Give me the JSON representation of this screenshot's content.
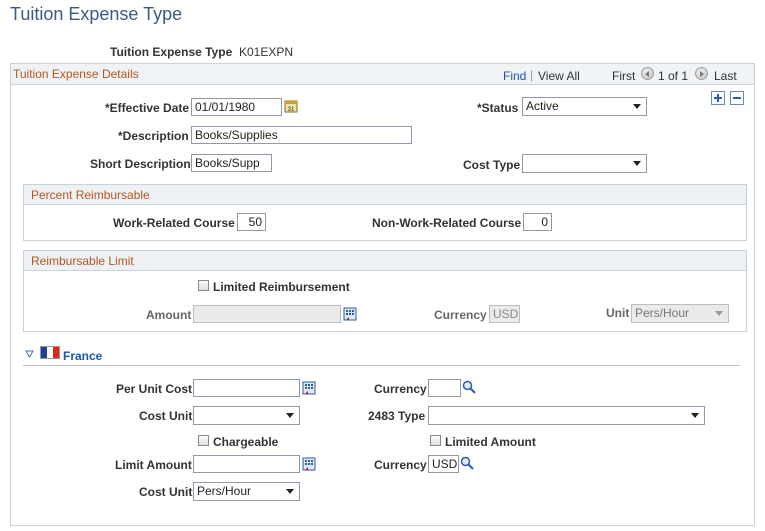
{
  "page": {
    "title": "Tuition Expense Type"
  },
  "header": {
    "type_label": "Tuition Expense Type",
    "type_value": "K01EXPN"
  },
  "details": {
    "title": "Tuition Expense Details",
    "nav": {
      "find": "Find",
      "sep": "|",
      "view_all": "View All",
      "first": "First",
      "position": "1 of 1",
      "last": "Last"
    },
    "effective_date_label": "*Effective Date",
    "effective_date_value": "01/01/1980",
    "status_label": "*Status",
    "status_value": "Active",
    "description_label": "*Description",
    "description_value": "Books/Supplies",
    "short_description_label": "Short Description",
    "short_description_value": "Books/Supp",
    "cost_type_label": "Cost Type",
    "cost_type_value": "",
    "percent": {
      "title": "Percent Reimbursable",
      "work_label": "Work-Related Course",
      "work_value": "50",
      "nonwork_label": "Non-Work-Related Course",
      "nonwork_value": "0"
    },
    "limit": {
      "title": "Reimbursable Limit",
      "limited_label": "Limited Reimbursement",
      "limited_checked": false,
      "amount_label": "Amount",
      "amount_value": "",
      "currency_label": "Currency",
      "currency_value": "USD",
      "unit_label": "Unit",
      "unit_value": "Pers/Hour"
    },
    "france": {
      "title": "France",
      "flag_colors": [
        "#1f3f9a",
        "#ffffff",
        "#e1251b"
      ],
      "per_unit_cost_label": "Per Unit Cost",
      "per_unit_cost_value": "",
      "currency_label": "Currency",
      "currency_value": "",
      "cost_unit_label": "Cost Unit",
      "cost_unit_value": "",
      "type_2483_label": "2483 Type",
      "type_2483_value": "",
      "chargeable_label": "Chargeable",
      "limited_amount_label": "Limited Amount",
      "limit_amount_label": "Limit Amount",
      "limit_amount_value": "",
      "currency2_label": "Currency",
      "currency2_value": "USD",
      "cost_unit2_label": "Cost Unit",
      "cost_unit2_value": "Pers/Hour"
    }
  },
  "icons": {
    "calendar": "calendar-icon",
    "lookup": "magnifier-icon",
    "prompt_calc": "calculator-prompt-icon",
    "add": "plus-icon",
    "delete": "minus-icon"
  }
}
